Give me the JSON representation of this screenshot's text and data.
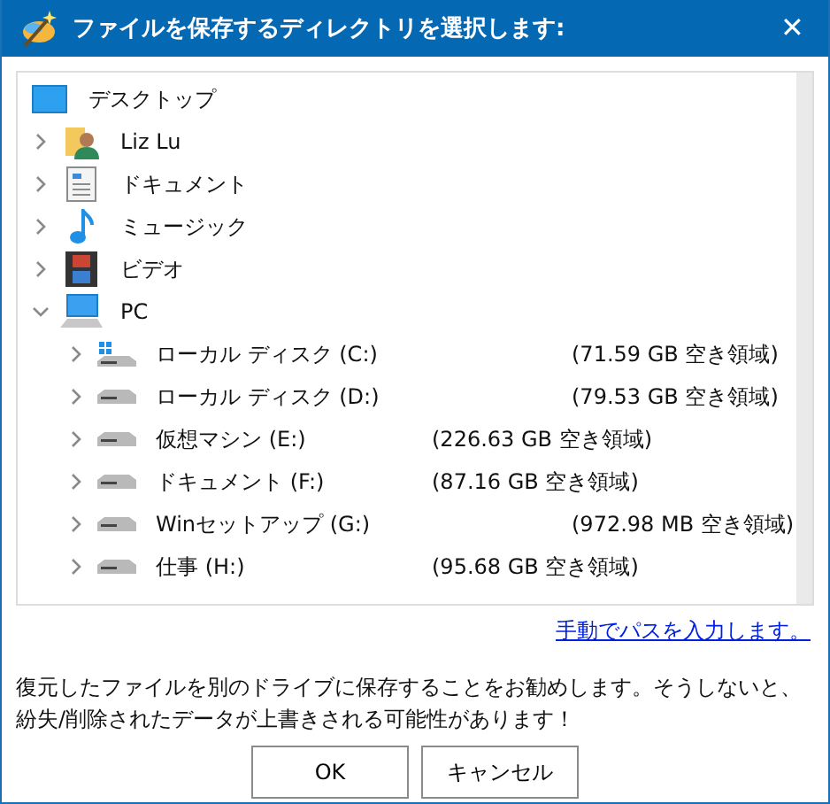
{
  "window": {
    "title": "ファイルを保存するディレクトリを選択します:",
    "close": "✕"
  },
  "tree": [
    {
      "label": "デスクトップ",
      "kind": "desktop"
    },
    {
      "label": "Liz Lu",
      "kind": "user",
      "expanded": false
    },
    {
      "label": "ドキュメント",
      "kind": "documents",
      "expanded": false
    },
    {
      "label": "ミュージック",
      "kind": "music",
      "expanded": false
    },
    {
      "label": "ビデオ",
      "kind": "video",
      "expanded": false
    },
    {
      "label": "PC",
      "kind": "pc",
      "expanded": true,
      "children": [
        {
          "label": "ローカル ディスク (C:)",
          "kind": "system-drive",
          "free": "(71.59 GB 空き領域)",
          "expanded": false
        },
        {
          "label": "ローカル ディスク (D:)",
          "kind": "drive",
          "free": "(79.53 GB 空き領域)",
          "expanded": false
        },
        {
          "label": "仮想マシン (E:)",
          "kind": "drive",
          "free": "(226.63 GB 空き領域)",
          "expanded": false
        },
        {
          "label": "ドキュメント (F:)",
          "kind": "drive",
          "free": "(87.16 GB 空き領域)",
          "expanded": false
        },
        {
          "label": "Winセットアップ (G:)",
          "kind": "drive",
          "free": "(972.98 MB 空き領域)",
          "expanded": false
        },
        {
          "label": "仕事 (H:)",
          "kind": "drive",
          "free": "(95.68 GB 空き領域)",
          "expanded": false
        }
      ]
    }
  ],
  "manual_path_link": "手動でパスを入力します。",
  "message": "復元したファイルを別のドライブに保存することをお勧めします。そうしないと、紛失/削除されたデータが上書きされる可能性があります！",
  "buttons": [
    "OK",
    "キャンセル"
  ]
}
